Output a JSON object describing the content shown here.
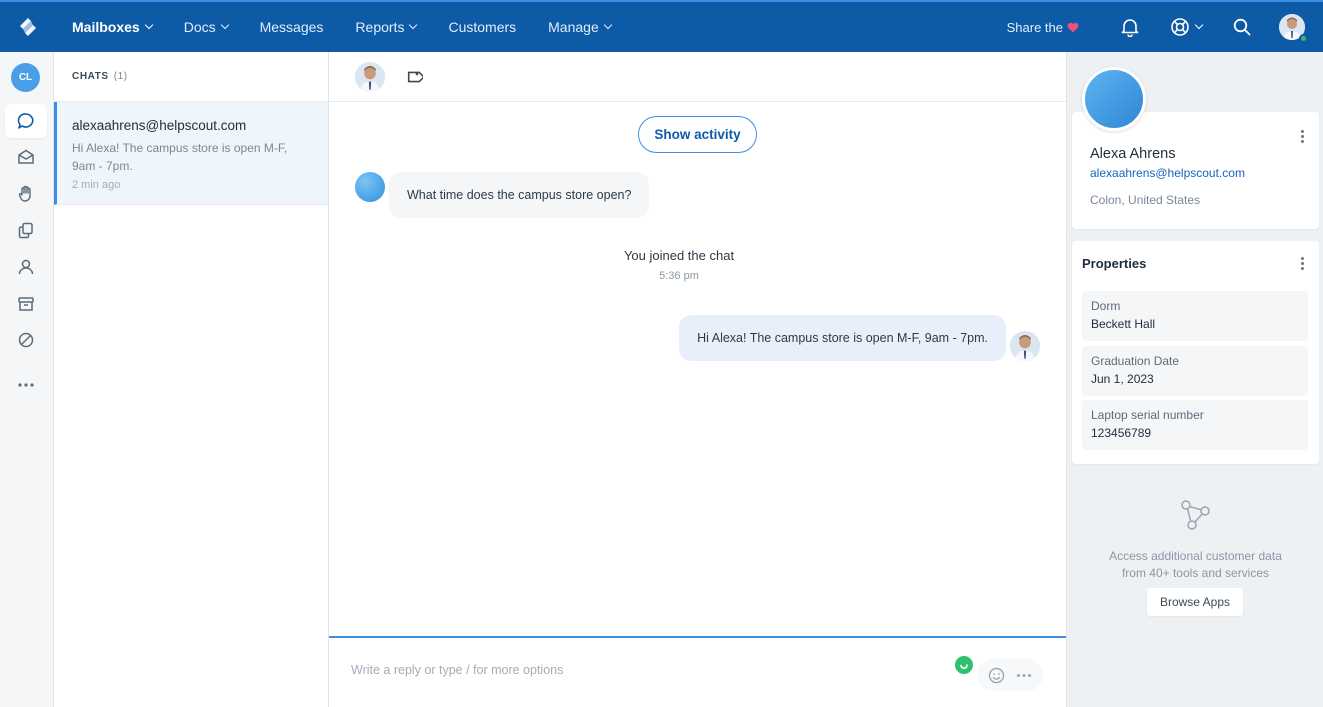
{
  "topnav": {
    "items": [
      {
        "label": "Mailboxes",
        "has_dropdown": true,
        "active": true
      },
      {
        "label": "Docs",
        "has_dropdown": true,
        "active": false
      },
      {
        "label": "Messages",
        "has_dropdown": false,
        "active": false
      },
      {
        "label": "Reports",
        "has_dropdown": true,
        "active": false
      },
      {
        "label": "Customers",
        "has_dropdown": false,
        "active": false
      },
      {
        "label": "Manage",
        "has_dropdown": true,
        "active": false
      }
    ],
    "share_label": "Share the",
    "icons": [
      "logo-icon",
      "heart-icon",
      "bell-icon",
      "help-icon",
      "search-icon",
      "user-avatar"
    ],
    "colors": {
      "bar": "#0d5aa7",
      "accent": "#3a8ee6",
      "heart": "#f0507a",
      "online": "#42b36b"
    }
  },
  "rail": {
    "avatar_initials": "CL",
    "icons": [
      "chat-icon",
      "inbox-icon",
      "hand-icon",
      "copy-icon",
      "person-icon",
      "archive-icon",
      "blocked-icon",
      "more-icon"
    ]
  },
  "chatlist": {
    "header": "CHATS",
    "count": "(1)",
    "chats": [
      {
        "email": "alexaahrens@helpscout.com",
        "preview": "Hi Alexa! The campus store is open M-F, 9am - 7pm.",
        "time": "2 min ago"
      }
    ]
  },
  "conversation": {
    "show_activity_label": "Show activity",
    "incoming_message": "What time does the campus store open?",
    "joined_text": "You joined the chat",
    "joined_time": "5:36 pm",
    "outgoing_message": "Hi Alexa! The campus store is open M-F, 9am - 7pm.",
    "composer_placeholder": "Write a reply or type / for more options"
  },
  "sidebar": {
    "customer": {
      "name": "Alexa Ahrens",
      "email": "alexaahrens@helpscout.com",
      "location": "Colon, United States"
    },
    "properties_title": "Properties",
    "properties": [
      {
        "label": "Dorm",
        "value": "Beckett Hall"
      },
      {
        "label": "Graduation Date",
        "value": "Jun 1, 2023"
      },
      {
        "label": "Laptop serial number",
        "value": "123456789"
      }
    ],
    "apps_text_line1": "Access additional customer data",
    "apps_text_line2": "from 40+ tools and services",
    "browse_apps_label": "Browse Apps"
  }
}
